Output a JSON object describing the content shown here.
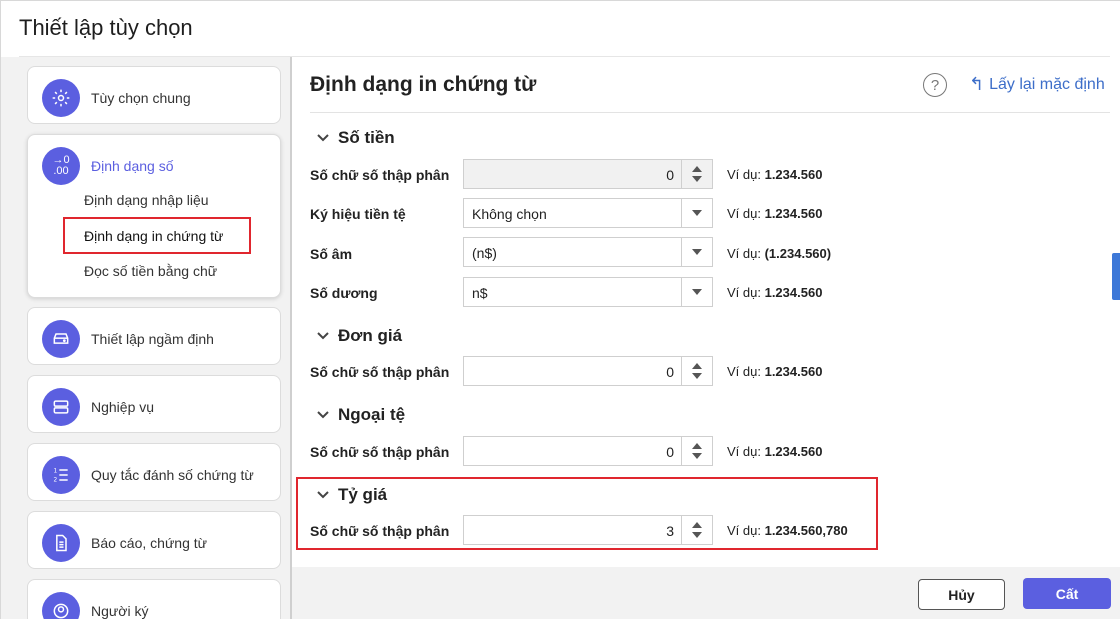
{
  "window": {
    "title": "Thiết lập tùy chọn"
  },
  "sidebar": {
    "items": [
      {
        "label": "Tùy chọn chung",
        "icon": "gear-icon"
      },
      {
        "label": "Định dạng số",
        "icon": "number-format-icon",
        "active": true,
        "subitems": [
          "Định dạng nhập liệu",
          "Định dạng in chứng từ",
          "Đọc số tiền bằng chữ"
        ],
        "selected_subitem": "Định dạng in chứng từ"
      },
      {
        "label": "Thiết lập ngầm định",
        "icon": "drive-icon"
      },
      {
        "label": "Nghiệp vụ",
        "icon": "server-icon"
      },
      {
        "label": "Quy tắc đánh số chứng từ",
        "icon": "numbered-list-icon"
      },
      {
        "label": "Báo cáo, chứng từ",
        "icon": "document-icon"
      },
      {
        "label": "Người ký",
        "icon": "user-icon"
      }
    ]
  },
  "main": {
    "title": "Định dạng in chứng từ",
    "help_label": "?",
    "reset_label": "Lấy lại mặc định",
    "reset_arrow": "↰",
    "sections": {
      "so_tien": {
        "title": "Số tiền",
        "rows": [
          {
            "label": "Số chữ số thập phân",
            "value": "0",
            "example_prefix": "Ví dụ:",
            "example": "1.234.560"
          },
          {
            "label": "Ký hiệu tiền tệ",
            "value": "Không chọn",
            "example_prefix": "Ví dụ:",
            "example": "1.234.560"
          },
          {
            "label": "Số âm",
            "value": "(n$)",
            "example_prefix": "Ví dụ:",
            "example": "(1.234.560)"
          },
          {
            "label": "Số dương",
            "value": "n$",
            "example_prefix": "Ví dụ:",
            "example": "1.234.560"
          }
        ]
      },
      "don_gia": {
        "title": "Đơn giá",
        "rows": [
          {
            "label": "Số chữ số thập phân",
            "value": "0",
            "example_prefix": "Ví dụ:",
            "example": "1.234.560"
          }
        ]
      },
      "ngoai_te": {
        "title": "Ngoại tệ",
        "rows": [
          {
            "label": "Số chữ số thập phân",
            "value": "0",
            "example_prefix": "Ví dụ:",
            "example": "1.234.560"
          }
        ]
      },
      "ty_gia": {
        "title": "Tỷ giá",
        "rows": [
          {
            "label": "Số chữ số thập phân",
            "value": "3",
            "example_prefix": "Ví dụ:",
            "example": "1.234.560,780"
          }
        ]
      }
    }
  },
  "footer": {
    "cancel_label": "Hủy",
    "save_label": "Cất"
  },
  "colors": {
    "accent": "#5b5fe0",
    "highlight": "#e0262e",
    "link": "#3d6ec9"
  }
}
